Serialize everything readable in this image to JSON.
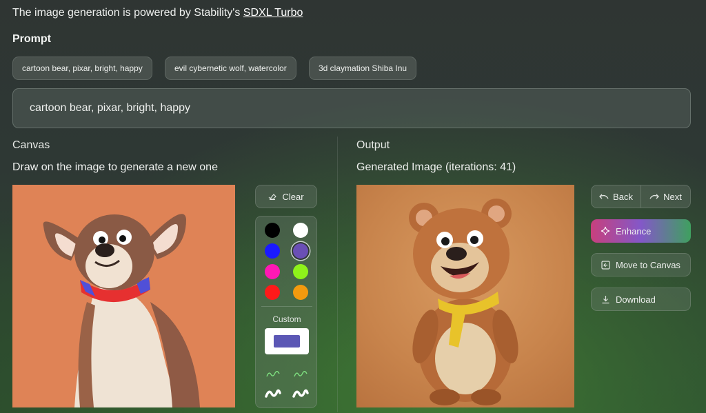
{
  "header": {
    "powered_prefix": "The image generation is powered by Stability's ",
    "powered_link": "SDXL Turbo"
  },
  "prompt": {
    "label": "Prompt",
    "examples": [
      "cartoon bear, pixar, bright, happy",
      "evil cybernetic wolf, watercolor",
      "3d claymation Shiba Inu"
    ],
    "value": "cartoon bear, pixar, bright, happy"
  },
  "canvas": {
    "title": "Canvas",
    "subtitle": "Draw on the image to generate a new one"
  },
  "output": {
    "title": "Output",
    "subtitle": "Generated Image (iterations: 41)"
  },
  "tools": {
    "clear_label": "Clear",
    "custom_label": "Custom",
    "custom_color": "#5b57b5",
    "colors": [
      "#000000",
      "#ffffff",
      "#1a1aff",
      "#6a4fb5",
      "#ff18b4",
      "#8ef21a",
      "#ff1a1a",
      "#f39a0e"
    ],
    "selected_color": "#6a4fb5"
  },
  "actions": {
    "back_label": "Back",
    "next_label": "Next",
    "enhance_label": "Enhance",
    "move_label": "Move to Canvas",
    "download_label": "Download"
  }
}
